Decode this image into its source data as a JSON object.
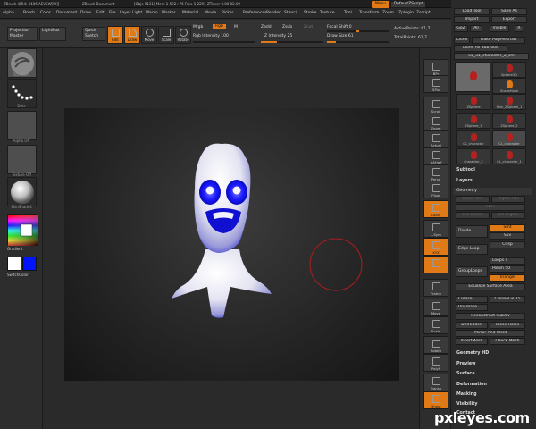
{
  "titlebar": {
    "left": "ZBrush 4[R4: 0406 AEVSW[W]]",
    "doc": "ZBrush Document",
    "status": "[Objs 9131]  Mem 1 592+76  Free 1 2291  ZTimer 0.00 02.09",
    "menu_btn": "Menu",
    "script_btn": "DefaultZScript"
  },
  "menus": [
    "Alpha",
    "Brush",
    "Color",
    "Document",
    "Draw",
    "Edit",
    "File",
    "Layer",
    "Light",
    "Macro",
    "Marker",
    "Material",
    "Movie",
    "Picker",
    "Preferences",
    "Render",
    "Stencil",
    "Stroke",
    "Texture",
    "Tool",
    "Transform",
    "Zoom",
    "Zplugin",
    "Zscript"
  ],
  "toolbar": {
    "projection_master": "Projection Master",
    "lightbox": "LightBox",
    "quick_sketch": "Quick Sketch",
    "edit": "Edit",
    "draw": "Draw",
    "move": "Move",
    "scale": "Scale",
    "rotate": "Rotate",
    "mrgb": "Mrgb",
    "rgb": "Rgb",
    "m": "M",
    "rgb_intensity": "Rgb Intensity 100",
    "zadd": "Zadd",
    "zsub": "Zsub",
    "zcut": "Zcut",
    "z_intensity": "Z Intensity 25",
    "focal_shift": "Focal Shift 0",
    "draw_size": "Draw Size 61",
    "active_points": "ActivePoints: 61,7",
    "total_points": "TotalPoints: 61,7"
  },
  "left_shelf": {
    "captions": [
      "Standard",
      "Dots",
      "Alpha Off",
      "Texture Off",
      "SkinShade4"
    ],
    "gradient": "Gradient",
    "switch_color": "SwitchColor"
  },
  "right_strip": [
    "BPr",
    "SPix",
    "Scroll",
    "Zoom",
    "Actual",
    "AAHalf",
    "Persp",
    "Floor",
    "Local",
    "L.Sym",
    "XYZ",
    "",
    "Frame",
    "Move",
    "Scale",
    "Rotate",
    "PolyF",
    "Transp",
    "Ghost",
    "Solo",
    "Xpose"
  ],
  "panel": {
    "top_rows": [
      [
        "Load Tool",
        "Save As"
      ],
      [
        "Import",
        "Export"
      ],
      [
        "GoZ",
        "All",
        "Visible",
        "R"
      ],
      [
        "Clone",
        "Make PolyMesh3D"
      ],
      [
        "Clone All SubTools"
      ]
    ],
    "tool_name": "CL_31_character_2_sm",
    "tools": [
      {
        "label": "Sphere3D"
      },
      {
        "label": "SnakeHook"
      },
      {
        "label": "ZSphere"
      },
      {
        "label": "Skin_ZSphere_1"
      },
      {
        "label": "ZSphere_1"
      },
      {
        "label": "ZSphere_2"
      },
      {
        "label": "CL_character"
      },
      {
        "label": "CL_character"
      },
      {
        "label": "character_2"
      },
      {
        "label": "CL_character_1"
      }
    ],
    "subtool": "Subtool",
    "layers": "Layers",
    "geometry": "Geometry",
    "geo_rows": [
      [
        "Lower Res",
        "Higher Res"
      ],
      [
        "SDiv"
      ],
      [
        "Del Lower",
        "Del Higher"
      ]
    ],
    "divide": "Divide",
    "smt": "Smt",
    "suv": "Suv",
    "crisp": "Crisp",
    "edge_loop": "Edge Loop",
    "loops": "Loops 4",
    "group_loops": "GroupLoops",
    "polish": "Polish 50",
    "triangle": "Triangle",
    "equalize": "Equalize Surface Area",
    "crease": "Crease",
    "crease_lvl": "CreaseLvl 15",
    "uncrease": "Uncrease",
    "reconstruct": "Reconstruct Subdiv",
    "delhidden": "DelHidden",
    "close_holes": "Close Holes",
    "mirror_weld": "Mirror And Weld",
    "insert_mesh": "InsertMesh",
    "check_mesh": "Check Mesh",
    "sections": [
      "Geometry HD",
      "Preview",
      "Surface",
      "Deformation",
      "Masking",
      "Visibility",
      "Contact"
    ]
  },
  "watermark": "pxleyes.com",
  "colors": {
    "accent": "#e07a16",
    "brush_ring": "#b01c1c",
    "primary_color": "#ffffff",
    "secondary_color": "#0015ff"
  }
}
